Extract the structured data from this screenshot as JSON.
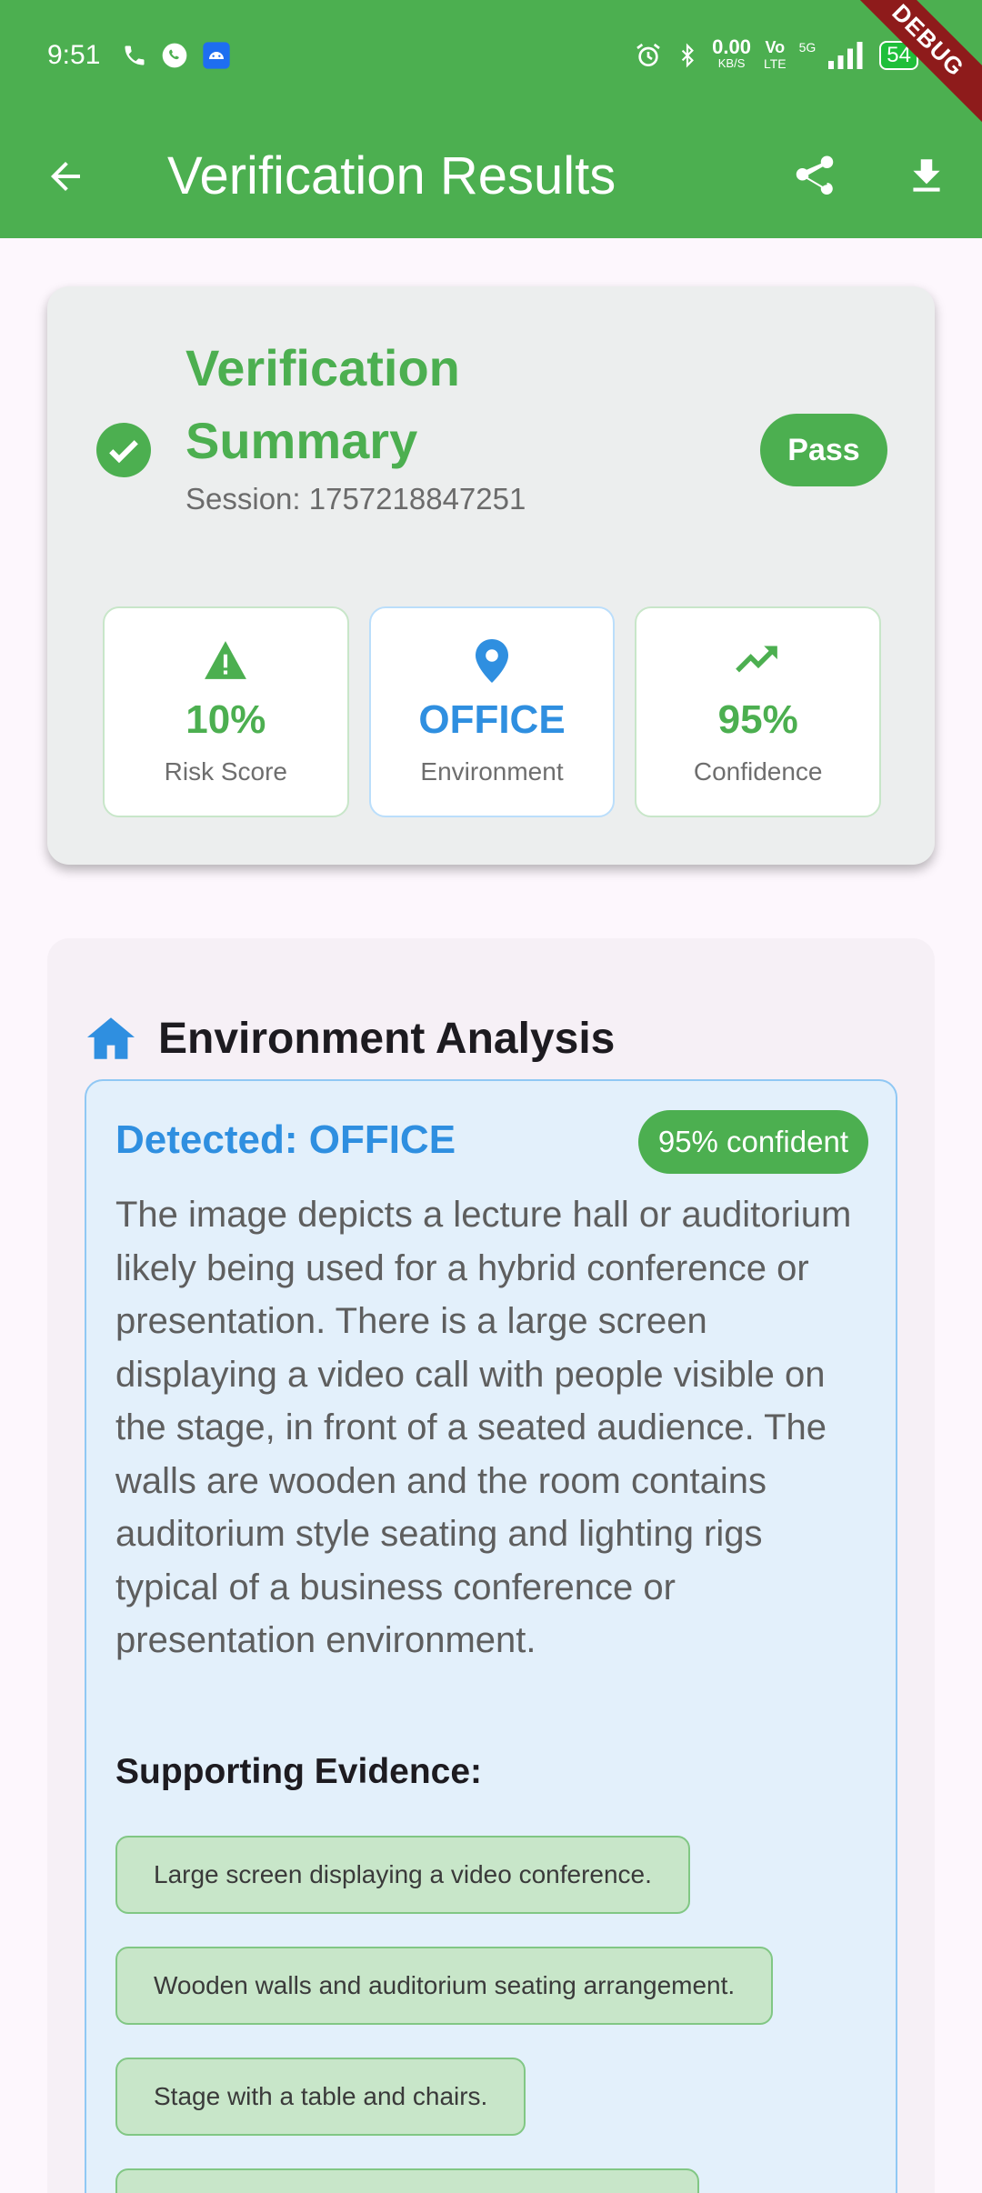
{
  "status_bar": {
    "time": "9:51",
    "net_speed": "0.00",
    "net_unit": "KB/S",
    "vo": "Vo",
    "lte": "LTE",
    "signal": "5G",
    "battery": "54"
  },
  "app_bar": {
    "title": "Verification Results",
    "debug_label": "DEBUG",
    "color": "#4caf50"
  },
  "summary": {
    "title": "Verification Summary",
    "session": "Session: 1757218847251",
    "status_pill": "Pass",
    "metrics": [
      {
        "value": "10%",
        "label": "Risk Score",
        "icon": "warning-icon",
        "color": "#4caf50"
      },
      {
        "value": "OFFICE",
        "label": "Environment",
        "icon": "location-pin-icon",
        "color": "#2f8fe0"
      },
      {
        "value": "95%",
        "label": "Confidence",
        "icon": "trending-up-icon",
        "color": "#4caf50"
      }
    ]
  },
  "environment": {
    "title": "Environment Analysis",
    "detected": "Detected: OFFICE",
    "confidence_pill": "95% confident",
    "description": "The image depicts a lecture hall or auditorium likely being used for a hybrid conference or presentation. There is a large screen displaying a video call with people visible on the stage, in front of a seated audience. The walls are wooden and the room contains auditorium style seating and lighting rigs typical of a business conference or presentation environment.",
    "evidence_title": "Supporting Evidence:",
    "evidence": [
      "Large screen displaying a video conference.",
      "Wooden walls and auditorium seating arrangement.",
      "Stage with a table and chairs."
    ]
  }
}
